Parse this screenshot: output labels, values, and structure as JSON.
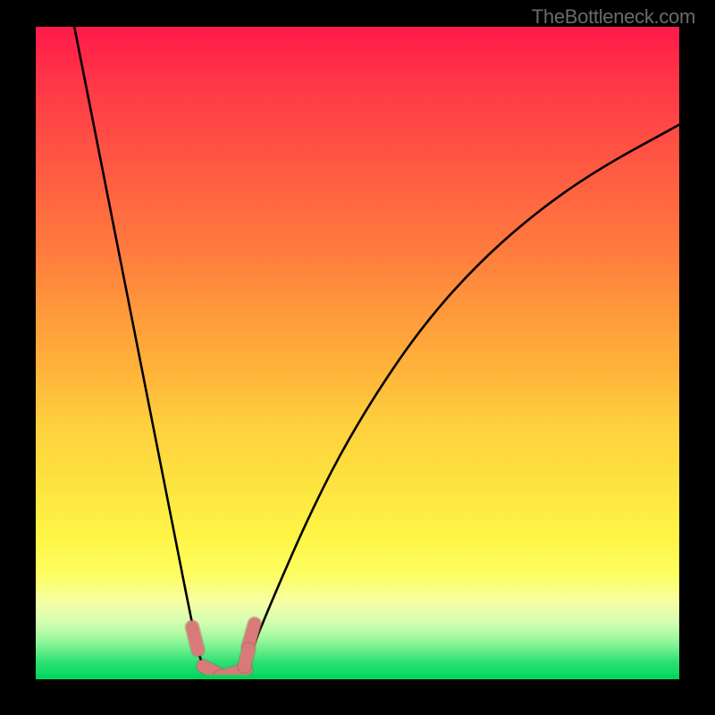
{
  "watermark": "TheBottleneck.com",
  "colors": {
    "background": "#000000",
    "curve_stroke": "#000000",
    "marker_fill": "#d87a77",
    "marker_stroke": "#a95857",
    "baseline": "#00d75f",
    "watermark": "#6b6a68"
  },
  "chart_data": {
    "type": "line",
    "title": "",
    "xlabel": "",
    "ylabel": "",
    "xlim": [
      0,
      100
    ],
    "ylim": [
      0,
      100
    ],
    "series": [
      {
        "name": "bottleneck-curve-left",
        "x": [
          6,
          8,
          10,
          12,
          14,
          16,
          18,
          20,
          22,
          24,
          25.5,
          27
        ],
        "values": [
          100,
          90,
          80,
          70,
          60,
          50,
          40,
          30,
          20,
          10,
          3,
          0
        ]
      },
      {
        "name": "bottleneck-curve-right",
        "x": [
          31,
          33,
          35,
          38,
          42,
          47,
          53,
          60,
          68,
          77,
          87,
          100
        ],
        "values": [
          0,
          3,
          8,
          15,
          24,
          34,
          44,
          54,
          63,
          71,
          78,
          85
        ]
      }
    ],
    "markers": [
      {
        "name": "marker-left-short",
        "x1": 24.3,
        "y1": 8.0,
        "x2": 25.2,
        "y2": 4.5
      },
      {
        "name": "marker-left-long",
        "x1": 26.0,
        "y1": 2.0,
        "x2": 29.0,
        "y2": 0.5
      },
      {
        "name": "marker-bottom-long",
        "x1": 28.5,
        "y1": 0.3,
        "x2": 32.7,
        "y2": 1.5
      },
      {
        "name": "marker-right-upper",
        "x1": 33.0,
        "y1": 5.0,
        "x2": 34.0,
        "y2": 8.5
      },
      {
        "name": "marker-right-lower",
        "x1": 32.4,
        "y1": 2.0,
        "x2": 33.1,
        "y2": 4.6
      }
    ]
  }
}
